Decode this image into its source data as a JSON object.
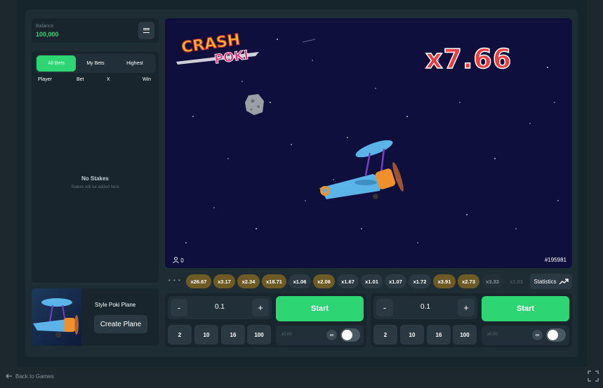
{
  "balance": {
    "label": "Balance",
    "value": "100,000"
  },
  "bets": {
    "tabs": [
      {
        "label": "All Bets"
      },
      {
        "label": "My Bets"
      },
      {
        "label": "Highest"
      }
    ],
    "columns": {
      "player": "Player",
      "bet": "Bet",
      "x": "X",
      "win": "Win"
    },
    "empty_title": "No Stakes",
    "empty_subtitle": "Stakes will be added here"
  },
  "promo": {
    "title": "Style Poki Plane",
    "button": "Create Plane"
  },
  "game": {
    "logo_line1": "CRASH",
    "logo_line2": "POKI",
    "multiplier": "x7.66",
    "players": "0",
    "round": "#195981"
  },
  "history": [
    {
      "value": "x26.67",
      "style": "gold"
    },
    {
      "value": "x3.17",
      "style": "gold"
    },
    {
      "value": "x2.34",
      "style": "gold"
    },
    {
      "value": "x18.71",
      "style": "gold"
    },
    {
      "value": "x1.06",
      "style": "grey"
    },
    {
      "value": "x2.06",
      "style": "gold"
    },
    {
      "value": "x1.67",
      "style": "grey"
    },
    {
      "value": "x1.01",
      "style": "grey"
    },
    {
      "value": "x1.07",
      "style": "grey"
    },
    {
      "value": "x1.72",
      "style": "grey"
    },
    {
      "value": "x3.91",
      "style": "gold"
    },
    {
      "value": "x2.73",
      "style": "gold"
    },
    {
      "value": "x3.33",
      "style": "fade"
    },
    {
      "value": "x1.83",
      "style": "fade2"
    }
  ],
  "statistics_label": "Statistics",
  "bet_panels": [
    {
      "amount": "0.1",
      "minus": "-",
      "plus": "+",
      "start": "Start",
      "quick": [
        "2",
        "10",
        "16",
        "100"
      ],
      "auto_placeholder": "x0.00",
      "inf": "∞"
    },
    {
      "amount": "0.1",
      "minus": "-",
      "plus": "+",
      "start": "Start",
      "quick": [
        "2",
        "10",
        "16",
        "100"
      ],
      "auto_placeholder": "x0.00",
      "inf": "∞"
    }
  ],
  "footer": {
    "back": "Back to Games"
  },
  "colors": {
    "accent": "#2ed573",
    "multiplier": "#ef3b3b",
    "sky": "#0e0f3d"
  },
  "icons": [
    "menu-icon",
    "user-icon",
    "trending-up-icon",
    "back-arrow-icon",
    "fullscreen-icon",
    "infinity-icon"
  ]
}
